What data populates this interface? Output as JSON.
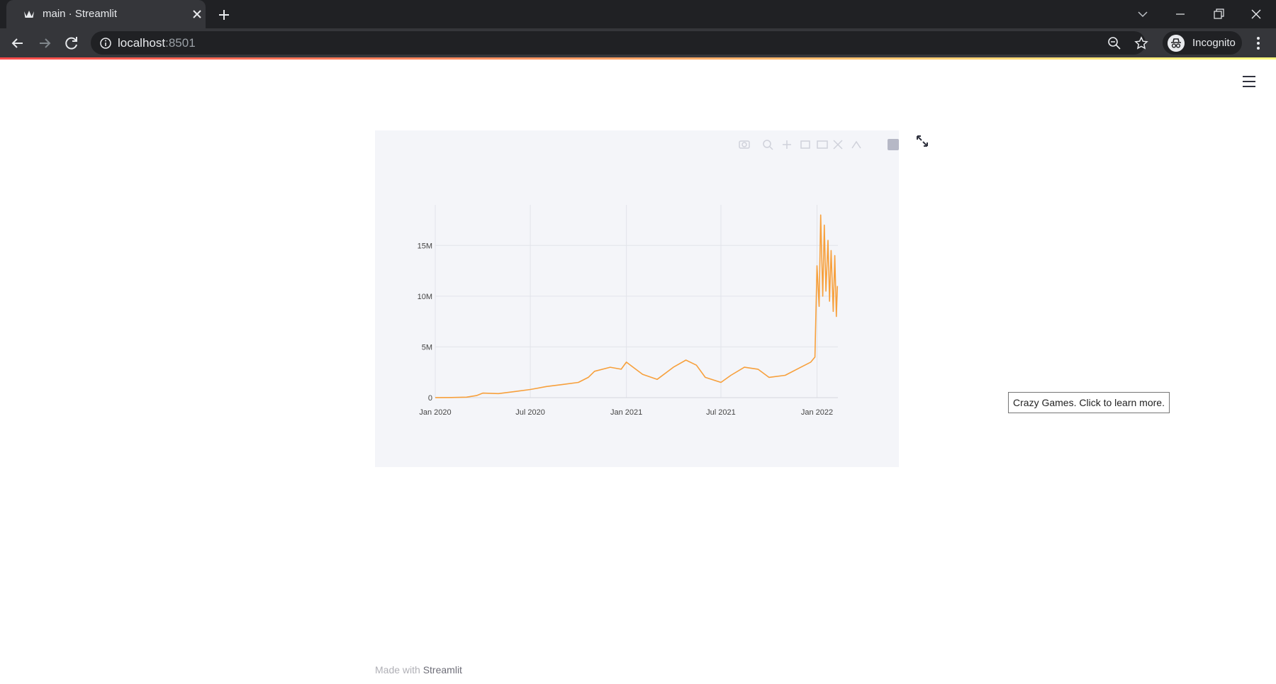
{
  "browser": {
    "tab_title": "main · Streamlit",
    "url_host": "localhost",
    "url_port": ":8501",
    "profile_label": "Incognito",
    "icons": {
      "favicon": "streamlit-crown-icon",
      "tab_close": "close-icon",
      "new_tab": "plus-icon",
      "back": "arrow-left-icon",
      "forward": "arrow-right-icon",
      "reload": "reload-icon",
      "site_info": "info-icon",
      "zoom": "zoom-out-icon",
      "bookmark": "star-icon",
      "incognito": "incognito-icon",
      "menu": "kebab-menu-icon",
      "window_controls": [
        "chevron-down-icon",
        "minimize-icon",
        "restore-icon",
        "close-icon"
      ]
    }
  },
  "page": {
    "tooltip": "Crazy Games. Click to learn more.",
    "footer_prefix": "Made with ",
    "footer_brand": "Streamlit",
    "icons": {
      "main_menu": "hamburger-menu-icon",
      "fullscreen": "expand-arrows-icon",
      "modebar": [
        "camera-icon",
        "zoom-icon",
        "pan-icon",
        "box-select-icon",
        "lasso-icon",
        "autoscale-icon",
        "reset-axes-icon",
        "plotly-logo-icon"
      ]
    }
  },
  "colors": {
    "line": "#f7a03c",
    "plot_bg": "#f4f5f9",
    "grid": "#e2e4ea",
    "decoration_start": "#ff4b4b",
    "decoration_end": "#fffd80"
  },
  "chart_data": {
    "type": "line",
    "title": "",
    "xlabel": "",
    "ylabel": "",
    "x_tick_labels": [
      "Jan 2020",
      "Jul 2020",
      "Jan 2021",
      "Jul 2021",
      "Jan 2022"
    ],
    "y_tick_labels": [
      "0",
      "5M",
      "10M",
      "15M"
    ],
    "y_ticks": [
      0,
      5000000,
      10000000,
      15000000
    ],
    "ylim": [
      0,
      19000000
    ],
    "xlim": [
      "2020-01-01",
      "2022-02-10"
    ],
    "grid": true,
    "legend": "none",
    "series": [
      {
        "x": [
          "2020-01-01",
          "2020-02-01",
          "2020-03-01",
          "2020-03-20",
          "2020-04-01",
          "2020-05-01",
          "2020-06-01",
          "2020-07-01",
          "2020-08-01",
          "2020-09-01",
          "2020-10-01",
          "2020-10-20",
          "2020-11-01",
          "2020-12-01",
          "2020-12-22",
          "2021-01-01",
          "2021-02-01",
          "2021-03-01",
          "2021-04-01",
          "2021-04-25",
          "2021-05-15",
          "2021-06-01",
          "2021-07-01",
          "2021-07-20",
          "2021-08-15",
          "2021-09-10",
          "2021-10-01",
          "2021-11-01",
          "2021-12-01",
          "2021-12-20",
          "2021-12-28",
          "2022-01-01",
          "2022-01-05",
          "2022-01-08",
          "2022-01-12",
          "2022-01-15",
          "2022-01-18",
          "2022-01-22",
          "2022-01-25",
          "2022-01-28",
          "2022-02-01",
          "2022-02-04",
          "2022-02-07",
          "2022-02-09"
        ],
        "y": [
          10000,
          15000,
          50000,
          200000,
          450000,
          400000,
          600000,
          800000,
          1100000,
          1300000,
          1500000,
          2000000,
          2600000,
          3000000,
          2800000,
          3500000,
          2300000,
          1800000,
          3000000,
          3700000,
          3200000,
          2000000,
          1500000,
          2200000,
          3000000,
          2800000,
          2000000,
          2200000,
          3000000,
          3500000,
          4000000,
          13000000,
          9000000,
          18000000,
          10000000,
          17000000,
          10500000,
          15500000,
          9500000,
          14500000,
          8500000,
          14000000,
          8000000,
          11000000
        ]
      }
    ]
  }
}
